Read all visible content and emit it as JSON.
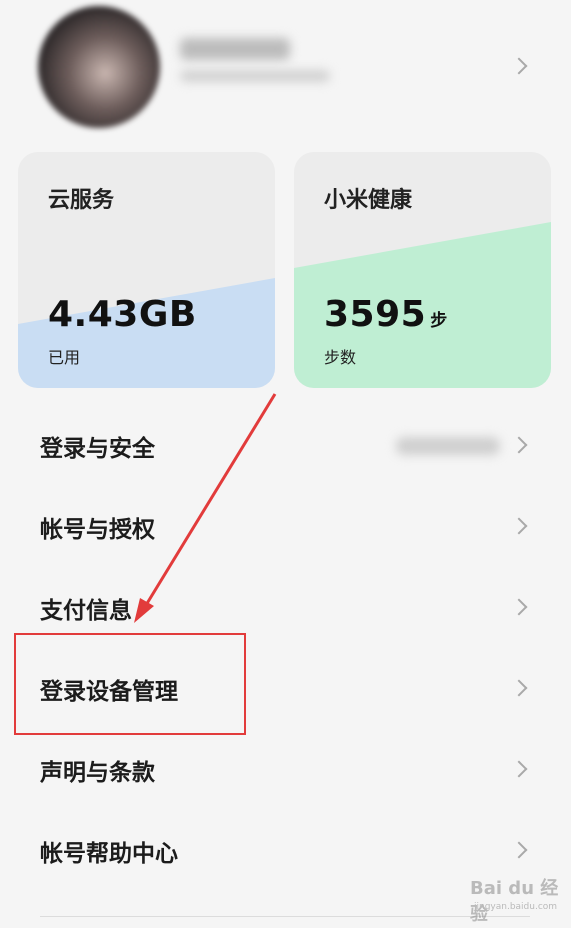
{
  "profile": {
    "name": "",
    "subtitle": ""
  },
  "cards": {
    "cloud": {
      "title": "云服务",
      "value": "4.43GB",
      "label": "已用",
      "color": "#c9ddf3"
    },
    "health": {
      "title": "小米健康",
      "value": "3595",
      "unit": "步",
      "label": "步数",
      "color": "#bfeed3"
    }
  },
  "menu": {
    "items": [
      {
        "label": "登录与安全",
        "value": ""
      },
      {
        "label": "帐号与授权"
      },
      {
        "label": "支付信息"
      },
      {
        "label": "登录设备管理"
      },
      {
        "label": "声明与条款"
      },
      {
        "label": "帐号帮助中心"
      }
    ]
  },
  "annotation": {
    "color": "#e23b3b",
    "highlighted_item": "登录设备管理"
  },
  "watermark": {
    "logo": "Bai du 经验",
    "url": "jingyan.baidu.com"
  }
}
